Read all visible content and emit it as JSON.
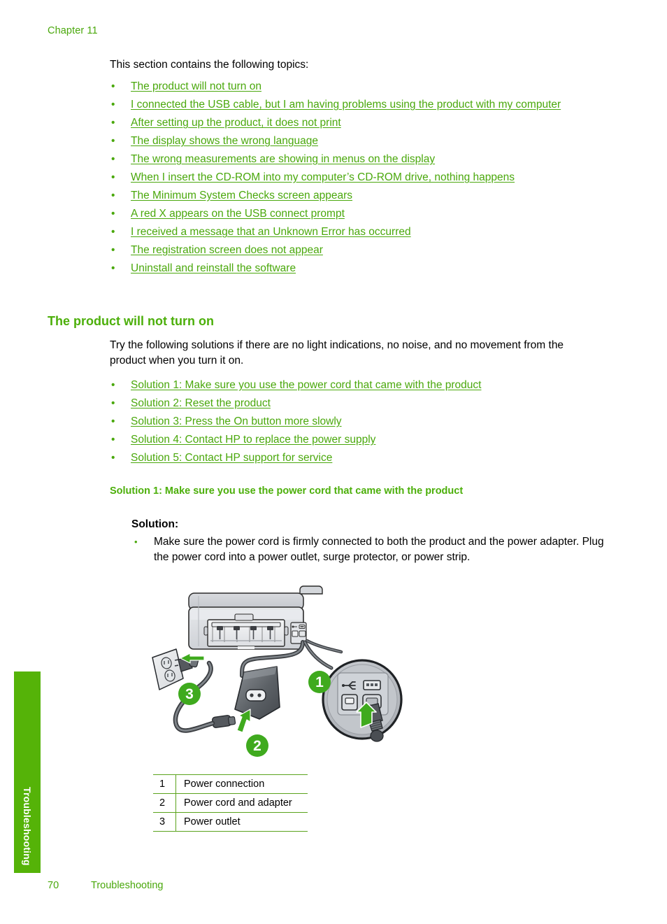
{
  "header": {
    "chapter": "Chapter 11"
  },
  "side_tab": {
    "label": "Troubleshooting",
    "color": "#55b308"
  },
  "colors": {
    "link_green": "#4aa80c",
    "heading_green": "#4caf0a",
    "tab_green": "#55b308",
    "rule_green": "#5aa31c",
    "callout_green": "#3faa1e"
  },
  "main": {
    "intro": "This section contains the following topics:",
    "topics": [
      "The product will not turn on",
      "I connected the USB cable, but I am having problems using the product with my computer",
      "After setting up the product, it does not print",
      "The display shows the wrong language",
      "The wrong measurements are showing in menus on the display",
      "When I insert the CD-ROM into my computer’s CD-ROM drive, nothing happens",
      "The Minimum System Checks screen appears",
      "A red X appears on the USB connect prompt",
      "I received a message that an Unknown Error has occurred",
      "The registration screen does not appear",
      "Uninstall and reinstall the software"
    ],
    "section_heading": "The product will not turn on",
    "section_intro": "Try the following solutions if there are no light indications, no noise, and no movement from the product when you turn it on.",
    "solution_links": [
      "Solution 1: Make sure you use the power cord that came with the product",
      "Solution 2: Reset the product",
      "Solution 3: Press the On button more slowly",
      "Solution 4: Contact HP to replace the power supply",
      "Solution 5: Contact HP support for service"
    ],
    "solution_heading": "Solution 1: Make sure you use the power cord that came with the product",
    "solution_label": "Solution:",
    "solution_body": "Make sure the power cord is firmly connected to both the product and the power adapter. Plug the power cord into a power outlet, surge protector, or power strip."
  },
  "figure": {
    "alt": "Rear view of the product showing the power connection, power cord with adapter, and wall power outlet",
    "callouts": [
      "1",
      "2",
      "3"
    ],
    "legend": [
      {
        "num": "1",
        "label": "Power connection"
      },
      {
        "num": "2",
        "label": "Power cord and adapter"
      },
      {
        "num": "3",
        "label": "Power outlet"
      }
    ]
  },
  "footer": {
    "page_number": "70",
    "section": "Troubleshooting"
  }
}
